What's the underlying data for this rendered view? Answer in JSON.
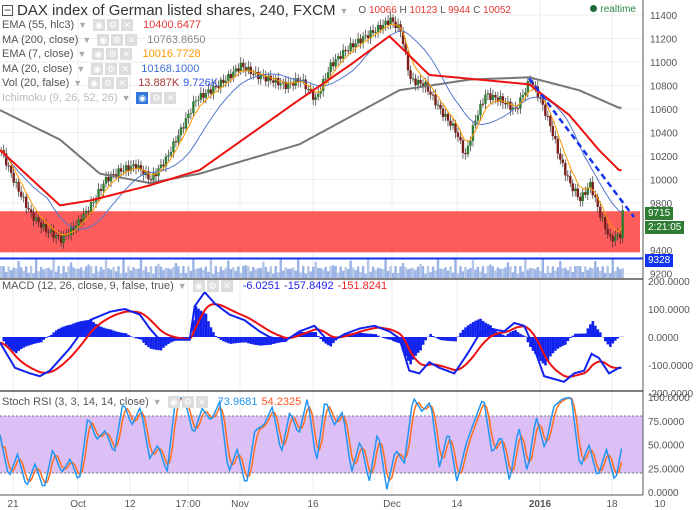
{
  "header": {
    "title": "DAX index of German listed shares, 240, FXCM",
    "ohlc": [
      {
        "k": "O",
        "v": "10066"
      },
      {
        "k": "H",
        "v": "10123"
      },
      {
        "k": "L",
        "v": "9944"
      },
      {
        "k": "C",
        "v": "10052"
      }
    ],
    "realtime": "realtime"
  },
  "legend": [
    {
      "label": "EMA (55, hlc3)",
      "values": [
        "10400.6477"
      ],
      "colors": [
        "#e53935"
      ]
    },
    {
      "label": "MA (200, close)",
      "values": [
        "10763.8650"
      ],
      "colors": [
        "#888888"
      ]
    },
    {
      "label": "EMA (7, close)",
      "values": [
        "10016.7728"
      ],
      "colors": [
        "#ff9800"
      ]
    },
    {
      "label": "MA (20, close)",
      "values": [
        "10168.1000"
      ],
      "colors": [
        "#3f6fd6"
      ]
    },
    {
      "label": "Vol (20, false)",
      "values": [
        "13.887K",
        "9.726K"
      ],
      "colors": [
        "#a33",
        "#3355ee"
      ]
    },
    {
      "label": "Ichimoku (9, 26, 52, 26)",
      "values": [],
      "colors": []
    }
  ],
  "macd_legend": {
    "label": "MACD (12, 26, close, 9, false, true)",
    "values": [
      "-6.0251",
      "-157.8492",
      "-151.8241"
    ],
    "colors": [
      "#2222ee",
      "#2222ee",
      "#ee2222"
    ]
  },
  "stoch_legend": {
    "label": "Stoch RSI (3, 3, 14, 14, close)",
    "values": [
      "73.9681",
      "54.2325"
    ],
    "colors": [
      "#2196f3",
      "#ff5722"
    ]
  },
  "tags": {
    "last": "9715",
    "countdown": "2:21:05",
    "support": "9328"
  },
  "colors": {
    "up": "#2e7d32",
    "down": "#7b1e1e",
    "ema55": "#ee1111",
    "ma200": "#777777",
    "ema7": "#ff9800",
    "ma20": "#5577cc",
    "zone": "#ff4040",
    "support": "#1133ee",
    "stochBand": "#dcc0f5"
  },
  "chart_data": [
    {
      "type": "candlestick",
      "title": "DAX index of German listed shares, 240, FXCM",
      "ylim": [
        9200,
        11500
      ],
      "yticks": [
        "11400",
        "11200",
        "11000",
        "10800",
        "10600",
        "10400",
        "10200",
        "10000",
        "9800",
        "9600",
        "9400",
        "9200"
      ],
      "xticks": [
        "21",
        "Oct",
        "12",
        "17:00",
        "Nov",
        "16",
        "Dec",
        "14",
        "2016",
        "18",
        "10"
      ],
      "close": [
        [
          0,
          10250
        ],
        [
          6,
          9950
        ],
        [
          12,
          9700
        ],
        [
          18,
          9570
        ],
        [
          24,
          9490
        ],
        [
          30,
          9610
        ],
        [
          36,
          9780
        ],
        [
          42,
          10000
        ],
        [
          48,
          10080
        ],
        [
          54,
          10120
        ],
        [
          60,
          10000
        ],
        [
          66,
          10170
        ],
        [
          72,
          10420
        ],
        [
          78,
          10680
        ],
        [
          84,
          10760
        ],
        [
          90,
          10850
        ],
        [
          96,
          10970
        ],
        [
          102,
          10890
        ],
        [
          108,
          10850
        ],
        [
          114,
          10800
        ],
        [
          120,
          10850
        ],
        [
          126,
          10680
        ],
        [
          132,
          10970
        ],
        [
          138,
          11100
        ],
        [
          144,
          11190
        ],
        [
          150,
          11270
        ],
        [
          156,
          11360
        ],
        [
          160,
          11270
        ],
        [
          164,
          10850
        ],
        [
          170,
          10800
        ],
        [
          176,
          10590
        ],
        [
          182,
          10420
        ],
        [
          186,
          10200
        ],
        [
          190,
          10510
        ],
        [
          194,
          10720
        ],
        [
          200,
          10680
        ],
        [
          206,
          10590
        ],
        [
          212,
          10850
        ],
        [
          216,
          10680
        ],
        [
          220,
          10460
        ],
        [
          224,
          10170
        ],
        [
          228,
          9960
        ],
        [
          232,
          9830
        ],
        [
          236,
          9960
        ],
        [
          240,
          9700
        ],
        [
          244,
          9490
        ],
        [
          248,
          9530
        ],
        [
          249,
          9715
        ]
      ],
      "ema55": [
        [
          0,
          10250
        ],
        [
          24,
          9780
        ],
        [
          36,
          9820
        ],
        [
          60,
          9950
        ],
        [
          80,
          10080
        ],
        [
          100,
          10380
        ],
        [
          120,
          10680
        ],
        [
          140,
          10970
        ],
        [
          156,
          11220
        ],
        [
          172,
          10890
        ],
        [
          192,
          10850
        ],
        [
          212,
          10810
        ],
        [
          228,
          10550
        ],
        [
          240,
          10250
        ],
        [
          248,
          10080
        ]
      ],
      "ma200": [
        [
          0,
          10590
        ],
        [
          24,
          10340
        ],
        [
          40,
          10050
        ],
        [
          60,
          9970
        ],
        [
          80,
          10050
        ],
        [
          120,
          10300
        ],
        [
          160,
          10760
        ],
        [
          188,
          10850
        ],
        [
          212,
          10870
        ],
        [
          232,
          10760
        ],
        [
          248,
          10610
        ]
      ],
      "zone": [
        9380,
        9730
      ],
      "support": 9328,
      "trendline": [
        [
          212,
          10860
        ],
        [
          254,
          9680
        ]
      ]
    },
    {
      "type": "line",
      "name": "MACD",
      "ylim": [
        -200,
        200
      ],
      "yticks": [
        "200.0000",
        "100.0000",
        "0.0000",
        "-100.0000",
        "-200.0000"
      ],
      "macd": [
        [
          0,
          -20
        ],
        [
          6,
          -110
        ],
        [
          12,
          -130
        ],
        [
          16,
          -140
        ],
        [
          20,
          -120
        ],
        [
          28,
          -40
        ],
        [
          36,
          60
        ],
        [
          44,
          90
        ],
        [
          50,
          100
        ],
        [
          56,
          80
        ],
        [
          60,
          30
        ],
        [
          64,
          -10
        ],
        [
          70,
          -10
        ],
        [
          76,
          -10
        ],
        [
          78,
          110
        ],
        [
          82,
          160
        ],
        [
          86,
          120
        ],
        [
          92,
          80
        ],
        [
          98,
          60
        ],
        [
          104,
          20
        ],
        [
          108,
          0
        ],
        [
          114,
          -15
        ],
        [
          120,
          20
        ],
        [
          126,
          40
        ],
        [
          132,
          -20
        ],
        [
          138,
          10
        ],
        [
          144,
          30
        ],
        [
          150,
          40
        ],
        [
          156,
          20
        ],
        [
          160,
          -5
        ],
        [
          164,
          -120
        ],
        [
          168,
          -130
        ],
        [
          172,
          -90
        ],
        [
          176,
          -110
        ],
        [
          182,
          -130
        ],
        [
          188,
          -50
        ],
        [
          192,
          10
        ],
        [
          196,
          30
        ],
        [
          202,
          20
        ],
        [
          206,
          50
        ],
        [
          210,
          40
        ],
        [
          214,
          -40
        ],
        [
          218,
          -140
        ],
        [
          222,
          -150
        ],
        [
          226,
          -160
        ],
        [
          230,
          -130
        ],
        [
          234,
          -120
        ],
        [
          237,
          -60
        ],
        [
          240,
          -75
        ],
        [
          244,
          -130
        ],
        [
          248,
          -110
        ]
      ]
    },
    {
      "type": "line",
      "name": "Stoch RSI",
      "ylim": [
        0,
        100
      ],
      "yticks": [
        "100.0000",
        "75.0000",
        "50.0000",
        "25.0000",
        "0.0000"
      ],
      "band": [
        20,
        80
      ],
      "k": [
        60,
        15,
        40,
        5,
        30,
        2,
        45,
        20,
        35,
        10,
        80,
        55,
        65,
        40,
        95,
        70,
        90,
        35,
        50,
        20,
        100,
        98,
        60,
        88,
        75,
        95,
        20,
        45,
        5,
        65,
        70,
        90,
        40,
        85,
        60,
        100,
        30,
        98,
        70,
        85,
        20,
        55,
        10,
        65,
        2,
        45,
        30,
        100,
        85,
        95,
        25,
        65,
        10,
        50,
        75,
        100,
        40,
        60,
        10,
        70,
        20,
        80,
        45,
        90,
        98,
        100,
        25,
        50,
        15,
        45,
        10,
        60
      ]
    }
  ]
}
